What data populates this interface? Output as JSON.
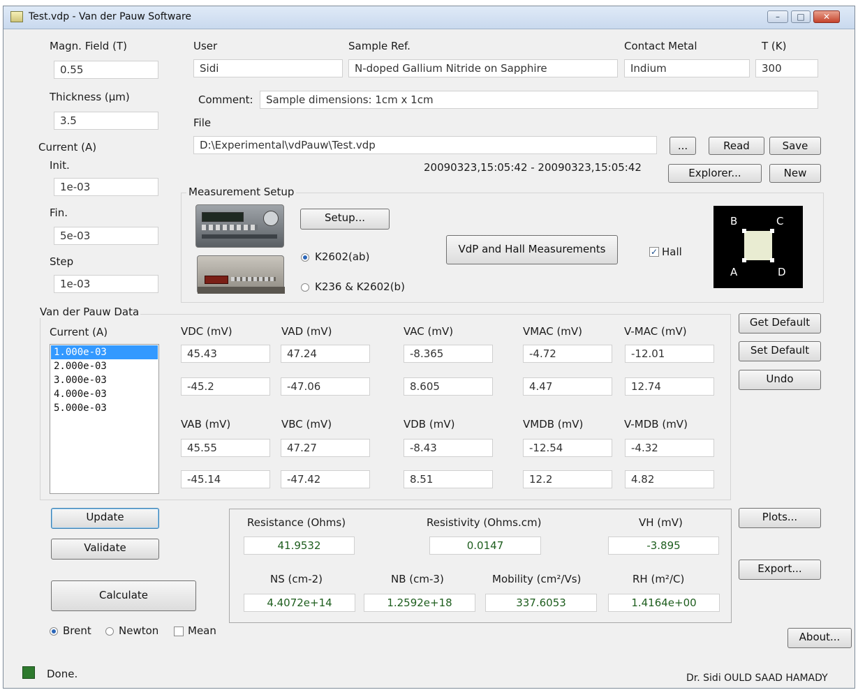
{
  "window": {
    "title": "Test.vdp - Van der Pauw Software"
  },
  "magn": {
    "label": "Magn. Field (T)",
    "value": "0.55"
  },
  "thickness": {
    "label": "Thickness (µm)",
    "value": "3.5"
  },
  "current": {
    "label": "Current (A)",
    "init_label": "Init.",
    "init_value": "1e-03",
    "fin_label": "Fin.",
    "fin_value": "5e-03",
    "step_label": "Step",
    "step_value": "1e-03"
  },
  "user": {
    "label": "User",
    "value": "Sidi"
  },
  "sample": {
    "label": "Sample Ref.",
    "value": "N-doped Gallium Nitride on Sapphire"
  },
  "contact": {
    "label": "Contact Metal",
    "value": "Indium"
  },
  "temp": {
    "label": "T (K)",
    "value": "300"
  },
  "comment": {
    "label": "Comment:",
    "value": "Sample dimensions: 1cm x 1cm"
  },
  "file": {
    "label": "File",
    "path": "D:\\Experimental\\vdPauw\\Test.vdp",
    "timestamp": "20090323,15:05:42 - 20090323,15:05:42",
    "browse": "...",
    "read": "Read",
    "save": "Save",
    "explorer": "Explorer...",
    "new": "New"
  },
  "setup": {
    "group_label": "Measurement Setup",
    "setup_button": "Setup...",
    "radio1": "K2602(ab)",
    "radio2": "K236 & K2602(b)",
    "measure_button": "VdP and Hall Measurements",
    "hall_label": "Hall",
    "hall_checked": true,
    "contacts": {
      "b": "B",
      "c": "C",
      "a": "A",
      "d": "D"
    }
  },
  "vdp": {
    "group_label": "Van der Pauw Data",
    "current_label": "Current (A)",
    "currents": [
      "1.000e-03",
      "2.000e-03",
      "3.000e-03",
      "4.000e-03",
      "5.000e-03"
    ],
    "headers1": [
      "VDC (mV)",
      "VAD (mV)",
      "VAC (mV)",
      "VMAC (mV)",
      "V-MAC (mV)"
    ],
    "row1": [
      "45.43",
      "47.24",
      "-8.365",
      "-4.72",
      "-12.01"
    ],
    "row2": [
      "-45.2",
      "-47.06",
      "8.605",
      "4.47",
      "12.74"
    ],
    "headers2": [
      "VAB (mV)",
      "VBC (mV)",
      "VDB (mV)",
      "VMDB (mV)",
      "V-MDB (mV)"
    ],
    "row3": [
      "45.55",
      "47.27",
      "-8.43",
      "-12.54",
      "-4.32"
    ],
    "row4": [
      "-45.14",
      "-47.42",
      "8.51",
      "12.2",
      "4.82"
    ]
  },
  "side": {
    "get_default": "Get Default",
    "set_default": "Set Default",
    "undo": "Undo",
    "plots": "Plots...",
    "export": "Export...",
    "about": "About..."
  },
  "actions": {
    "update": "Update",
    "validate": "Validate",
    "calculate": "Calculate"
  },
  "method": {
    "brent": "Brent",
    "newton": "Newton",
    "mean": "Mean",
    "selected": "Brent",
    "mean_checked": false
  },
  "results": {
    "resistance_label": "Resistance (Ohms)",
    "resistance": "41.9532",
    "resistivity_label": "Resistivity (Ohms.cm)",
    "resistivity": "0.0147",
    "vh_label": "VH (mV)",
    "vh": "-3.895",
    "ns_label": "NS (cm-2)",
    "ns": "4.4072e+14",
    "nb_label": "NB (cm-3)",
    "nb": "1.2592e+18",
    "mobility_label": "Mobility (cm²/Vs)",
    "mobility": "337.6053",
    "rh_label": "RH (m²/C)",
    "rh": "1.4164e+00"
  },
  "status": {
    "text": "Done.",
    "author": "Dr. Sidi OULD SAAD HAMADY"
  }
}
